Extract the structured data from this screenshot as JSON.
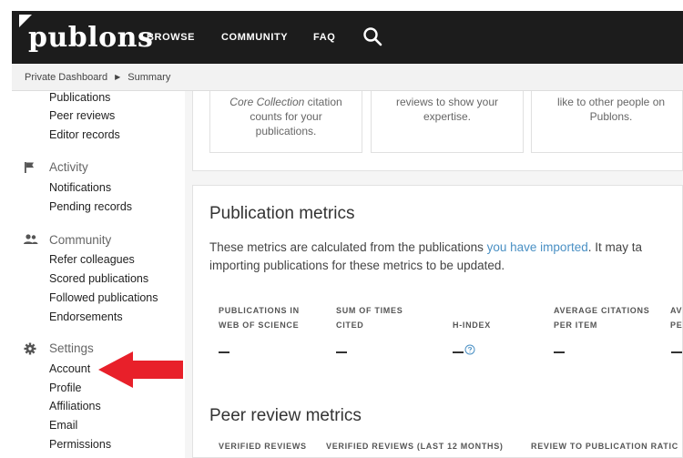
{
  "header": {
    "logo_text": "publons",
    "nav": [
      "BROWSE",
      "COMMUNITY",
      "FAQ"
    ]
  },
  "breadcrumb": [
    "Private Dashboard",
    "Summary"
  ],
  "sidebar": {
    "publications_links": [
      "Publications",
      "Peer reviews",
      "Editor records"
    ],
    "activity": {
      "heading": "Activity",
      "links": [
        "Notifications",
        "Pending records"
      ]
    },
    "community": {
      "heading": "Community",
      "links": [
        "Refer colleagues",
        "Scored publications",
        "Followed publications",
        "Endorsements"
      ]
    },
    "settings": {
      "heading": "Settings",
      "links": [
        "Account",
        "Profile",
        "Affiliations",
        "Email",
        "Permissions"
      ]
    }
  },
  "tiles": [
    {
      "italic": "Core Collection",
      "lines": [
        "citation",
        "counts for your",
        "publications."
      ]
    },
    {
      "lines": [
        "reviews to show your",
        "expertise."
      ]
    },
    {
      "lines": [
        "like to other people on",
        "Publons."
      ]
    }
  ],
  "publication_metrics": {
    "title": "Publication metrics",
    "desc_before": "These metrics are calculated from the publications ",
    "desc_link": "you have imported",
    "desc_after": ".  It may ta",
    "desc_line2": "importing publications for these metrics to be updated.",
    "columns": [
      {
        "line1": "PUBLICATIONS IN",
        "line2": "WEB OF SCIENCE",
        "value": "–"
      },
      {
        "line1": "SUM OF TIMES",
        "line2": "CITED",
        "value": "–"
      },
      {
        "line1": "",
        "line2": "H-INDEX",
        "value": "–"
      },
      {
        "line1": "AVERAGE CITATIONS",
        "line2": "PER ITEM",
        "value": "–"
      },
      {
        "line1": "AV",
        "line2": "PE",
        "value": "–"
      }
    ]
  },
  "peer_review_metrics": {
    "title": "Peer review metrics",
    "columns": [
      "VERIFIED REVIEWS",
      "VERIFIED REVIEWS (LAST 12 MONTHS)",
      "REVIEW TO PUBLICATION RATIC"
    ]
  },
  "colors": {
    "header_bg": "#1c1c1c",
    "link": "#4a90c4",
    "arrow": "#e8202a"
  }
}
